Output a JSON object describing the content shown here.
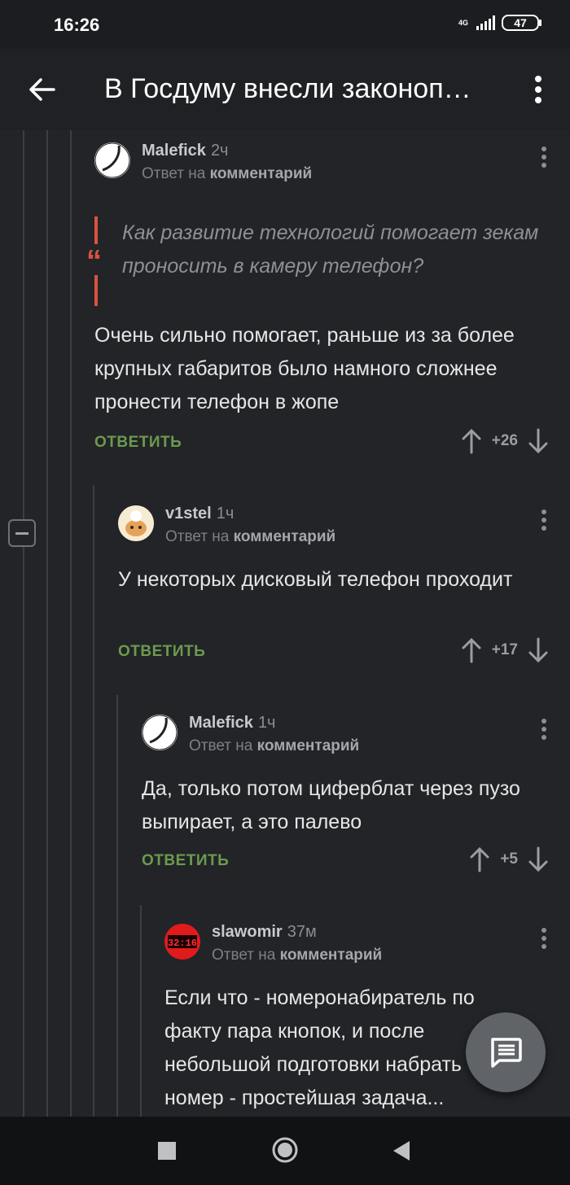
{
  "status": {
    "time": "16:26",
    "network": "4G",
    "battery": "47"
  },
  "app_bar": {
    "title": "В Госдуму внесли законоп…"
  },
  "comments": [
    {
      "author": "Malefick",
      "time": "2ч",
      "reply_prefix": "Ответ на",
      "reply_target": "комментарий",
      "quote": "Как развитие технологий помогает зекам проносить в камеру телефон?",
      "text": "Очень сильно помогает, раньше из за более крупных габаритов было намного сложнее пронести телефон в жопе",
      "reply_label": "ОТВЕТИТЬ",
      "votes": "+26"
    },
    {
      "author": "v1stel",
      "time": "1ч",
      "reply_prefix": "Ответ на",
      "reply_target": "комментарий",
      "text": "У некоторых дисковый телефон проходит",
      "reply_label": "ОТВЕТИТЬ",
      "votes": "+17"
    },
    {
      "author": "Malefick",
      "time": "1ч",
      "reply_prefix": "Ответ на",
      "reply_target": "комментарий",
      "text": "Да, только потом циферблат через пузо выпирает, а это палево",
      "reply_label": "ОТВЕТИТЬ",
      "votes": "+5"
    },
    {
      "author": "slawomir",
      "time": "37м",
      "reply_prefix": "Ответ на",
      "reply_target": "комментарий",
      "avatar_text": "32:16",
      "text": "Если что - номеронабиратель по факту пара кнопок, и после небольшой подготовки набрать номер - простейшая задача..."
    }
  ],
  "icons": {
    "back": "arrow-left-icon",
    "menu": "more-vertical-icon",
    "upvote": "arrow-up-icon",
    "downvote": "arrow-down-icon",
    "fab": "comment-icon",
    "collapse": "minus-icon"
  },
  "colors": {
    "accent_green": "#6c9a4f",
    "quote_red": "#d9533f",
    "background": "#222427"
  }
}
